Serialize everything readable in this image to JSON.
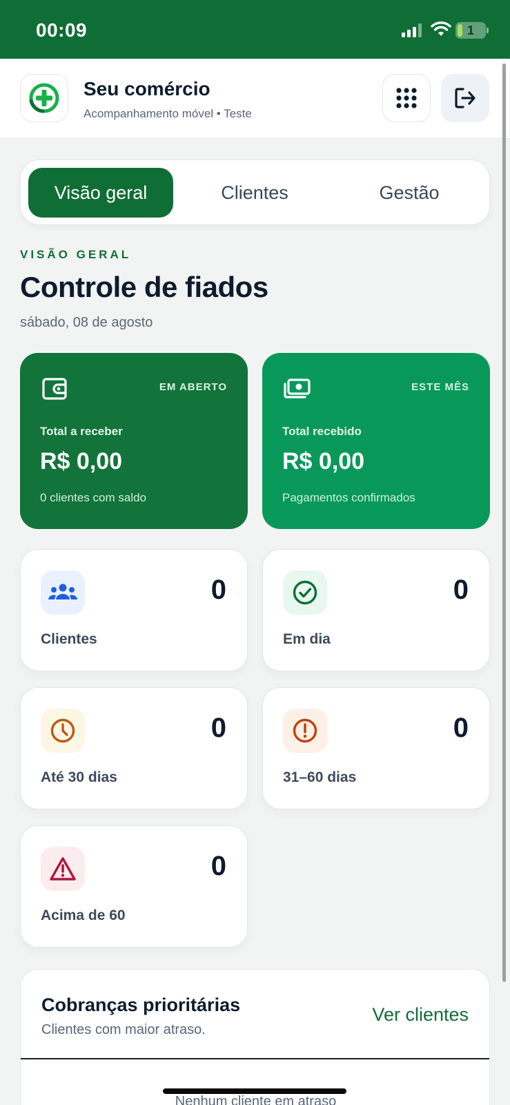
{
  "status_bar": {
    "time": "00:09",
    "battery": "1"
  },
  "header": {
    "title": "Seu comércio",
    "subtitle": "Acompanhamento móvel • Teste",
    "logo_icon": "plus-circle-icon",
    "apps_icon": "grid-dots-icon",
    "logout_icon": "logout-icon"
  },
  "tabs": [
    {
      "label": "Visão geral",
      "active": true
    },
    {
      "label": "Clientes",
      "active": false
    },
    {
      "label": "Gestão",
      "active": false
    }
  ],
  "overview": {
    "eyebrow": "VISÃO GERAL",
    "title": "Controle de fiados",
    "date": "sábado, 08 de agosto"
  },
  "summary_cards": [
    {
      "tag": "EM ABERTO",
      "label": "Total a receber",
      "value": "R$ 0,00",
      "note": "0 clientes com saldo",
      "icon": "wallet-icon",
      "color": "#12743a"
    },
    {
      "tag": "ESTE MÊS",
      "label": "Total recebido",
      "value": "R$ 0,00",
      "note": "Pagamentos confirmados",
      "icon": "cash-icon",
      "color": "#08995a"
    }
  ],
  "stats": {
    "clients": {
      "label": "Clientes",
      "value": "0",
      "icon": "users-icon"
    },
    "em_dia": {
      "label": "Em dia",
      "value": "0",
      "icon": "check-circle-icon"
    },
    "ate_30": {
      "label": "Até 30 dias",
      "value": "0",
      "icon": "clock-icon"
    },
    "d31_60": {
      "label": "31–60 dias",
      "value": "0",
      "icon": "alert-circle-icon"
    },
    "acima_60": {
      "label": "Acima de 60",
      "value": "0",
      "icon": "warning-triangle-icon"
    }
  },
  "priority": {
    "title": "Cobranças prioritárias",
    "subtitle": "Clientes com maior atraso.",
    "link": "Ver clientes",
    "empty": "Nenhum cliente em atraso"
  },
  "colors": {
    "brand": "#0f6e35",
    "accent": "#08995a",
    "background": "#f2f4f3"
  }
}
